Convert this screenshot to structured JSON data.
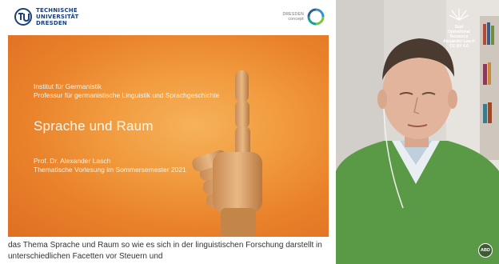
{
  "slide": {
    "university_logo": {
      "line1": "TECHNISCHE",
      "line2": "UNIVERSITÄT",
      "line3": "DRESDEN"
    },
    "dresden_concept_logo": {
      "line1": "DRESDEN",
      "line2": "concept"
    },
    "institute_line1": "Institut für Germanistik",
    "institute_line2": "Professur für germanistische Linguistik und Sprachgeschichte",
    "title": "Sprache und Raum",
    "author": "Prof. Dr. Alexander Lasch",
    "lecture": "Thematische Vorlesung im Sommersemester 2021"
  },
  "caption": {
    "line1": "das Thema Sprache und Raum so wie es sich in der linguistischen Forschung darstellt in",
    "line2": "unterschiedlichen Facetten vor Steuern und"
  },
  "webcam": {
    "logo": {
      "line1": "Sept",
      "line2": "Operational",
      "line3": "Resource",
      "line4": "Alexander Lasch",
      "line5": "CC BY 4.0"
    },
    "badge": "ABD"
  },
  "colors": {
    "slide_orange": "#e9812a",
    "tud_blue": "#1b3f7a",
    "sweater_green": "#5a9a47"
  }
}
